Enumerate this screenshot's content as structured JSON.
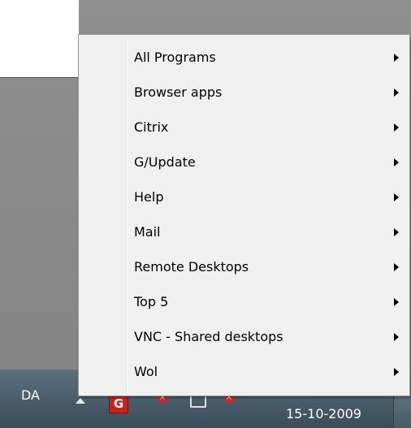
{
  "menu": {
    "items": [
      {
        "label": "All Programs",
        "icon": "submenu-arrow-icon"
      },
      {
        "label": "Browser apps",
        "icon": "submenu-arrow-icon"
      },
      {
        "label": "Citrix",
        "icon": "submenu-arrow-icon"
      },
      {
        "label": "G/Update",
        "icon": "submenu-arrow-icon"
      },
      {
        "label": "Help",
        "icon": "submenu-arrow-icon"
      },
      {
        "label": "Mail",
        "icon": "submenu-arrow-icon"
      },
      {
        "label": "Remote Desktops",
        "icon": "submenu-arrow-icon"
      },
      {
        "label": "Top 5",
        "icon": "submenu-arrow-icon"
      },
      {
        "label": "VNC - Shared desktops",
        "icon": "submenu-arrow-icon"
      },
      {
        "label": "Wol",
        "icon": "submenu-arrow-icon"
      }
    ]
  },
  "taskbar": {
    "language": "DA",
    "date": "15-10-2009",
    "tray_icons": [
      "show-hidden-icons-icon",
      "g-app-icon",
      "network-error-icon",
      "monitor-icon",
      "muted-speaker-icon"
    ],
    "tray_g_letter": "G",
    "tray_x_glyph": "×"
  },
  "colors": {
    "menu_background": "#f0f0f0",
    "taskbar": "#3b4d59",
    "tray_alert": "#d52525",
    "g_app": "#c9211e"
  }
}
